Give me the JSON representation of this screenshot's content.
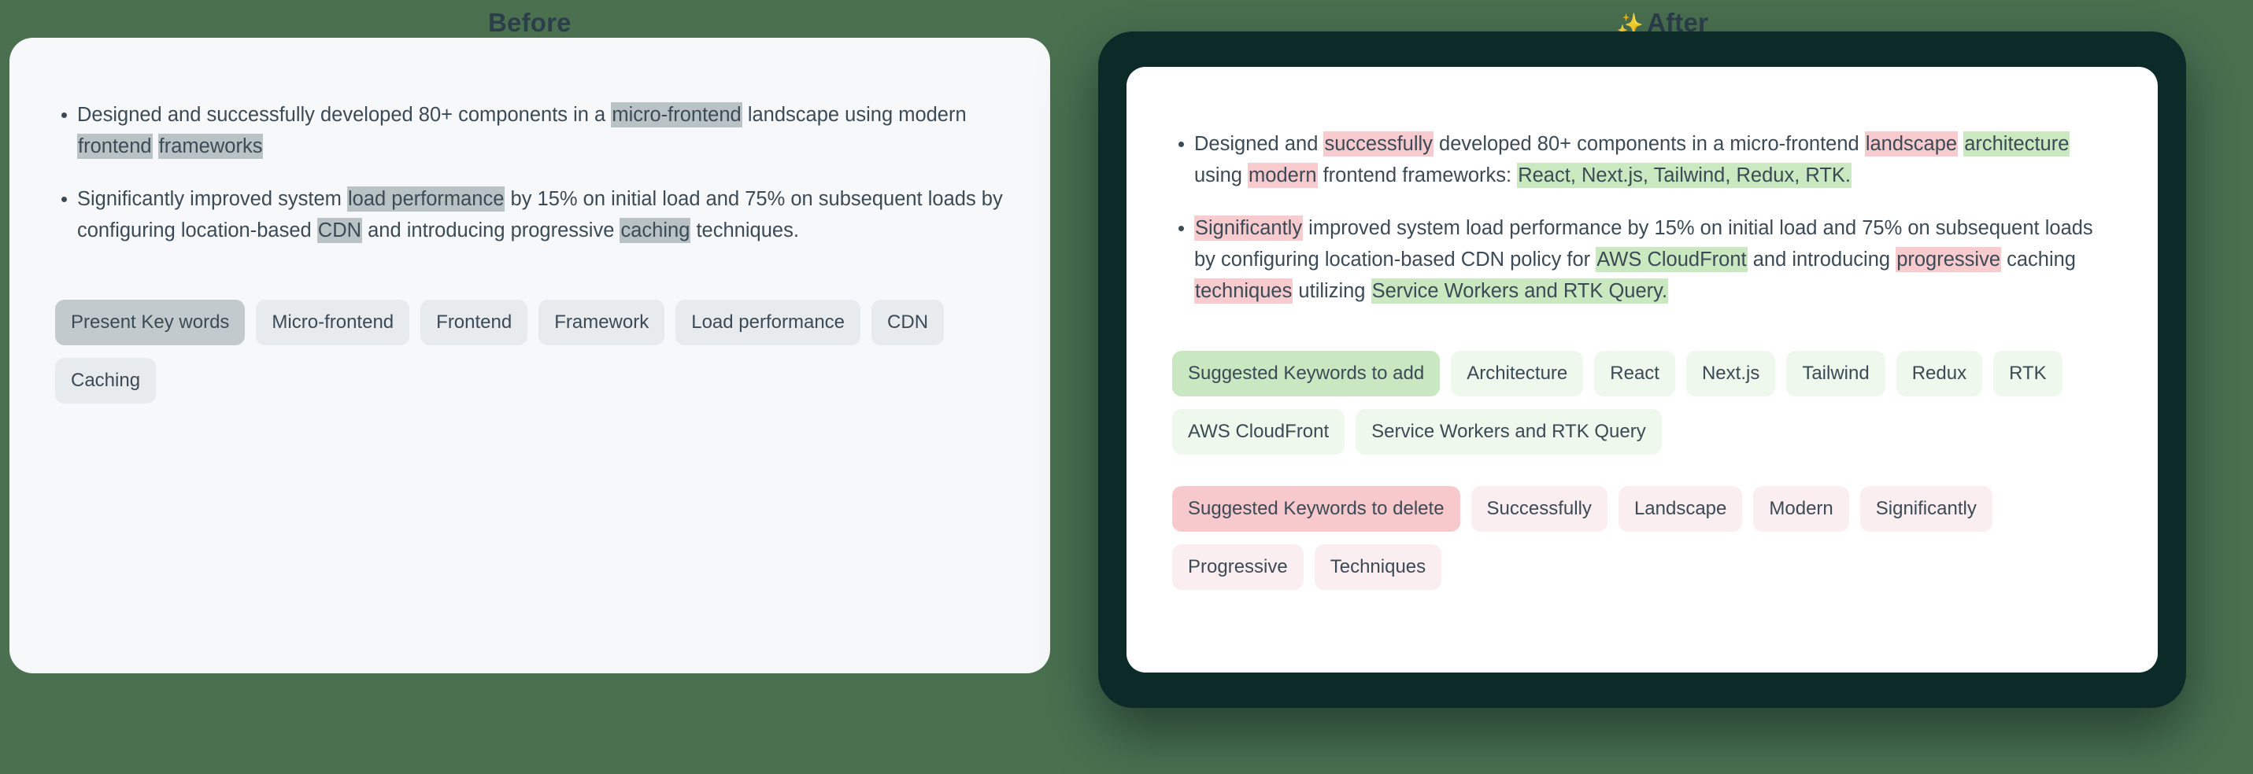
{
  "background_color": "#4a7050",
  "panels": {
    "before": {
      "title": "Before",
      "card_color": "#f6f8fa",
      "highlight_color": "#b9c3c5",
      "bullets": [
        {
          "segments": [
            {
              "text": "Designed and successfully developed 80+ components in a ",
              "highlight": "none"
            },
            {
              "text": "micro-frontend",
              "highlight": "gray"
            },
            {
              "text": " landscape using modern ",
              "highlight": "none"
            },
            {
              "text": "frontend",
              "highlight": "gray"
            },
            {
              "text": " ",
              "highlight": "none"
            },
            {
              "text": "frameworks",
              "highlight": "gray"
            }
          ]
        },
        {
          "segments": [
            {
              "text": "Significantly improved system ",
              "highlight": "none"
            },
            {
              "text": "load performance",
              "highlight": "gray"
            },
            {
              "text": " by 15% on initial load and 75% on subsequent loads by configuring location-based ",
              "highlight": "none"
            },
            {
              "text": "CDN",
              "highlight": "gray"
            },
            {
              "text": " and introducing progressive ",
              "highlight": "none"
            },
            {
              "text": "caching",
              "highlight": "gray"
            },
            {
              "text": " techniques.",
              "highlight": "none"
            }
          ]
        }
      ],
      "chip_groups": [
        {
          "name": "present-keywords",
          "chips": [
            {
              "label": "Present Key words",
              "style": "gray-strong"
            },
            {
              "label": "Micro-frontend",
              "style": "gray"
            },
            {
              "label": "Frontend",
              "style": "gray"
            },
            {
              "label": "Framework",
              "style": "gray"
            },
            {
              "label": "Load performance",
              "style": "gray"
            },
            {
              "label": "CDN",
              "style": "gray"
            },
            {
              "label": "Caching",
              "style": "gray"
            }
          ]
        }
      ]
    },
    "after": {
      "title": "After",
      "title_icon": "sparkles-icon",
      "title_icon_glyph": "✨",
      "frame_color": "#0c2a28",
      "card_color": "#ffffff",
      "add_highlight_color": "#cae9c1",
      "delete_highlight_color": "#f8cbcf",
      "bullets": [
        {
          "segments": [
            {
              "text": "Designed and ",
              "highlight": "none"
            },
            {
              "text": "successfully",
              "highlight": "pink"
            },
            {
              "text": " developed 80+ components in a micro-frontend ",
              "highlight": "none"
            },
            {
              "text": "landscape",
              "highlight": "pink"
            },
            {
              "text": " ",
              "highlight": "none"
            },
            {
              "text": "architecture",
              "highlight": "green"
            },
            {
              "text": " using ",
              "highlight": "none"
            },
            {
              "text": "modern",
              "highlight": "pink"
            },
            {
              "text": " frontend frameworks: ",
              "highlight": "none"
            },
            {
              "text": "React, Next.js, Tailwind, Redux, RTK.",
              "highlight": "green"
            }
          ]
        },
        {
          "segments": [
            {
              "text": "Significantly",
              "highlight": "pink"
            },
            {
              "text": " improved system load performance by 15% on initial load and 75% on subsequent loads by configuring location-based CDN policy for ",
              "highlight": "none"
            },
            {
              "text": "AWS CloudFront",
              "highlight": "green"
            },
            {
              "text": " and introducing ",
              "highlight": "none"
            },
            {
              "text": "progressive",
              "highlight": "pink"
            },
            {
              "text": " caching ",
              "highlight": "none"
            },
            {
              "text": "techniques",
              "highlight": "pink"
            },
            {
              "text": " utilizing ",
              "highlight": "none"
            },
            {
              "text": "Service Workers and RTK Query.",
              "highlight": "green"
            }
          ]
        }
      ],
      "chip_groups": [
        {
          "name": "suggested-keywords-to-add",
          "chips": [
            {
              "label": "Suggested Keywords to add",
              "style": "green-strong"
            },
            {
              "label": "Architecture",
              "style": "green"
            },
            {
              "label": "React",
              "style": "green"
            },
            {
              "label": "Next.js",
              "style": "green"
            },
            {
              "label": "Tailwind",
              "style": "green"
            },
            {
              "label": "Redux",
              "style": "green"
            },
            {
              "label": "RTK",
              "style": "green"
            },
            {
              "label": "AWS CloudFront",
              "style": "green"
            },
            {
              "label": "Service Workers and RTK Query",
              "style": "green"
            }
          ]
        },
        {
          "name": "suggested-keywords-to-delete",
          "chips": [
            {
              "label": "Suggested Keywords to delete",
              "style": "pink-strong"
            },
            {
              "label": "Successfully",
              "style": "pink"
            },
            {
              "label": "Landscape",
              "style": "pink"
            },
            {
              "label": "Modern",
              "style": "pink"
            },
            {
              "label": "Significantly",
              "style": "pink"
            },
            {
              "label": "Progressive",
              "style": "pink"
            },
            {
              "label": "Techniques",
              "style": "pink"
            }
          ]
        }
      ]
    }
  }
}
